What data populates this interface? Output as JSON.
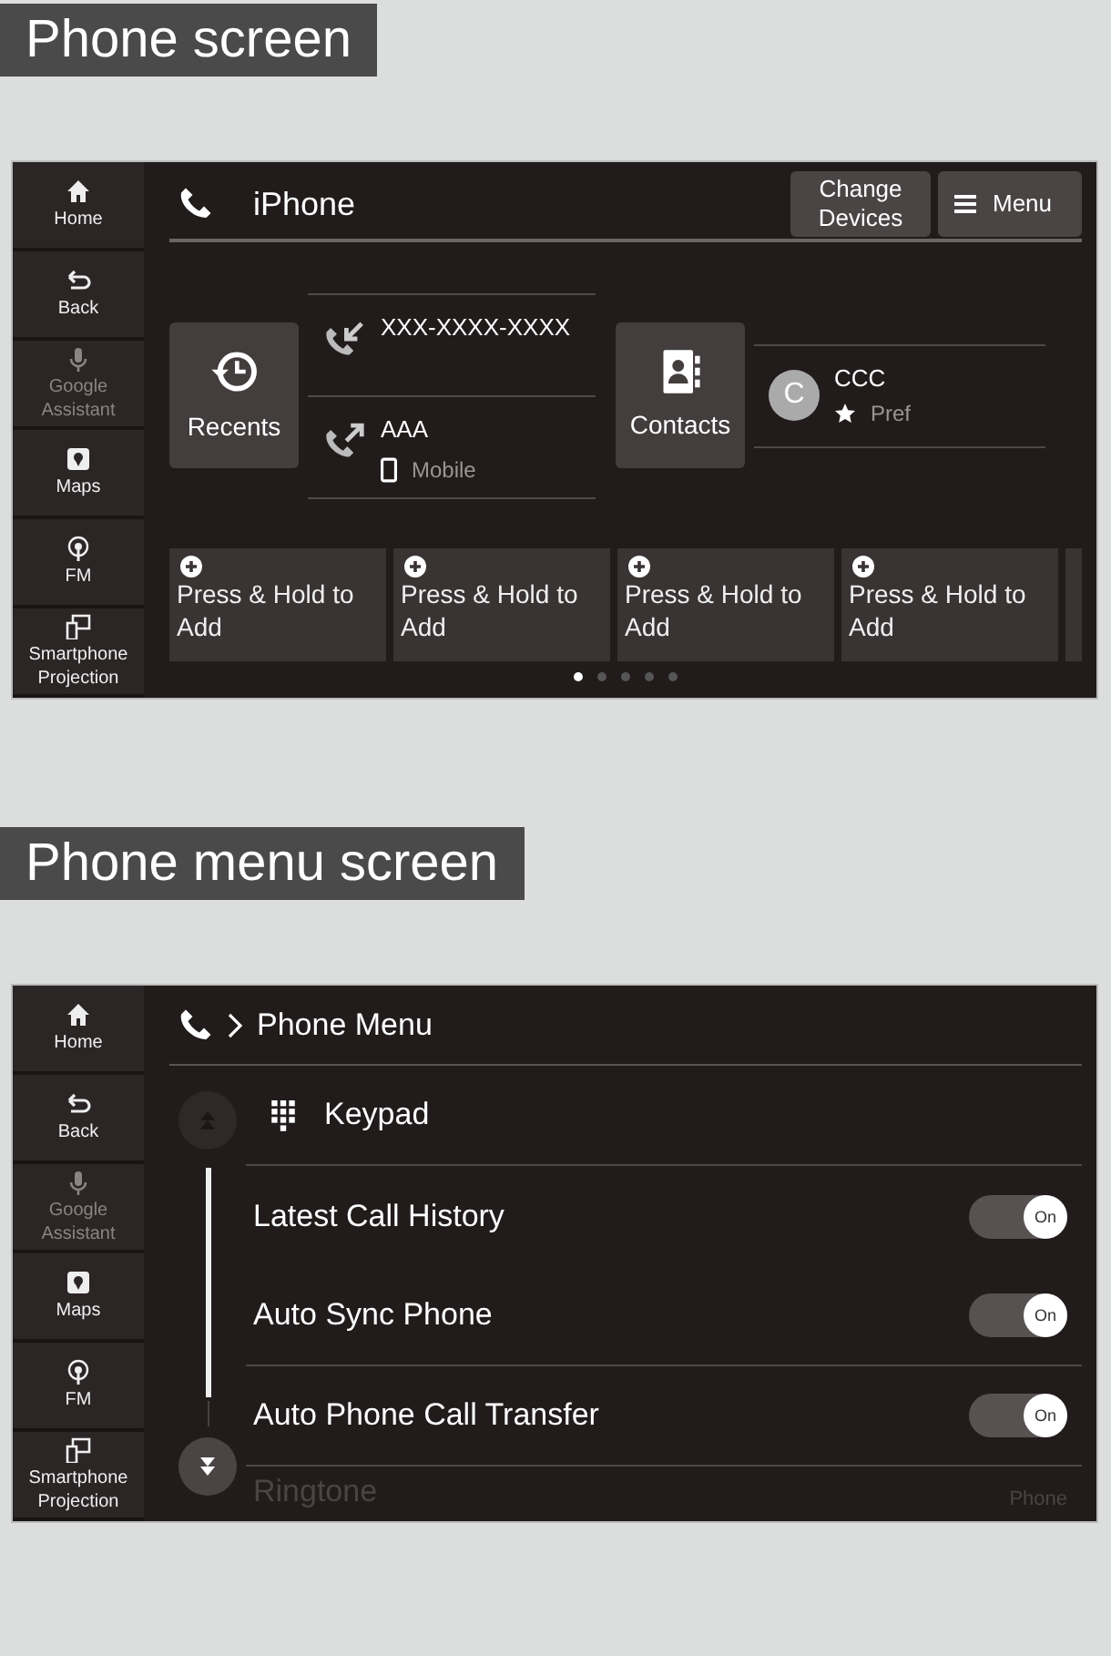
{
  "phone_screen": {
    "heading": "Phone screen",
    "sidebar": [
      {
        "label": "Home",
        "disabled": false
      },
      {
        "label": "Back",
        "disabled": false
      },
      {
        "label": "Google Assistant",
        "disabled": true
      },
      {
        "label": "Maps",
        "disabled": false
      },
      {
        "label": "FM",
        "disabled": false
      },
      {
        "label": "Smartphone Projection",
        "disabled": false
      }
    ],
    "title": "iPhone",
    "buttons": [
      "Change Devices",
      "Menu"
    ],
    "recents": {
      "label": "Recents",
      "entries": [
        {
          "kind": "incoming",
          "name": "XXX-XXXX-XXXX"
        },
        {
          "kind": "outgoing",
          "name": "AAA",
          "detail": "Mobile"
        }
      ]
    },
    "contacts": {
      "label": "Contacts",
      "entries": [
        {
          "initial": "C",
          "name": "CCC",
          "detail": "Pref"
        }
      ]
    },
    "quick_dial": [
      "Press & Hold to Add",
      "Press & Hold to Add",
      "Press & Hold to Add",
      "Press & Hold to Add"
    ],
    "pages": [
      {
        "selected": true
      },
      {
        "selected": false
      },
      {
        "selected": false
      },
      {
        "selected": false
      },
      {
        "selected": false
      }
    ]
  },
  "phone_menu_screen": {
    "heading": "Phone menu screen",
    "sidebar": [
      {
        "label": "Home",
        "disabled": false
      },
      {
        "label": "Back",
        "disabled": false
      },
      {
        "label": "Google Assistant",
        "disabled": true
      },
      {
        "label": "Maps",
        "disabled": false
      },
      {
        "label": "FM",
        "disabled": false
      },
      {
        "label": "Smartphone Projection",
        "disabled": false
      }
    ],
    "breadcrumb": "Phone Menu",
    "items": [
      {
        "kind": "link",
        "label": "Keypad"
      },
      {
        "kind": "toggle",
        "label": "Latest Call History",
        "on": true,
        "state_label": "On"
      },
      {
        "kind": "toggle",
        "label": "Auto Sync Phone",
        "on": true,
        "state_label": "On"
      },
      {
        "kind": "toggle",
        "label": "Auto Phone Call Transfer",
        "on": true,
        "state_label": "On"
      },
      {
        "kind": "value",
        "label": "Ringtone",
        "value": "Phone"
      }
    ]
  }
}
